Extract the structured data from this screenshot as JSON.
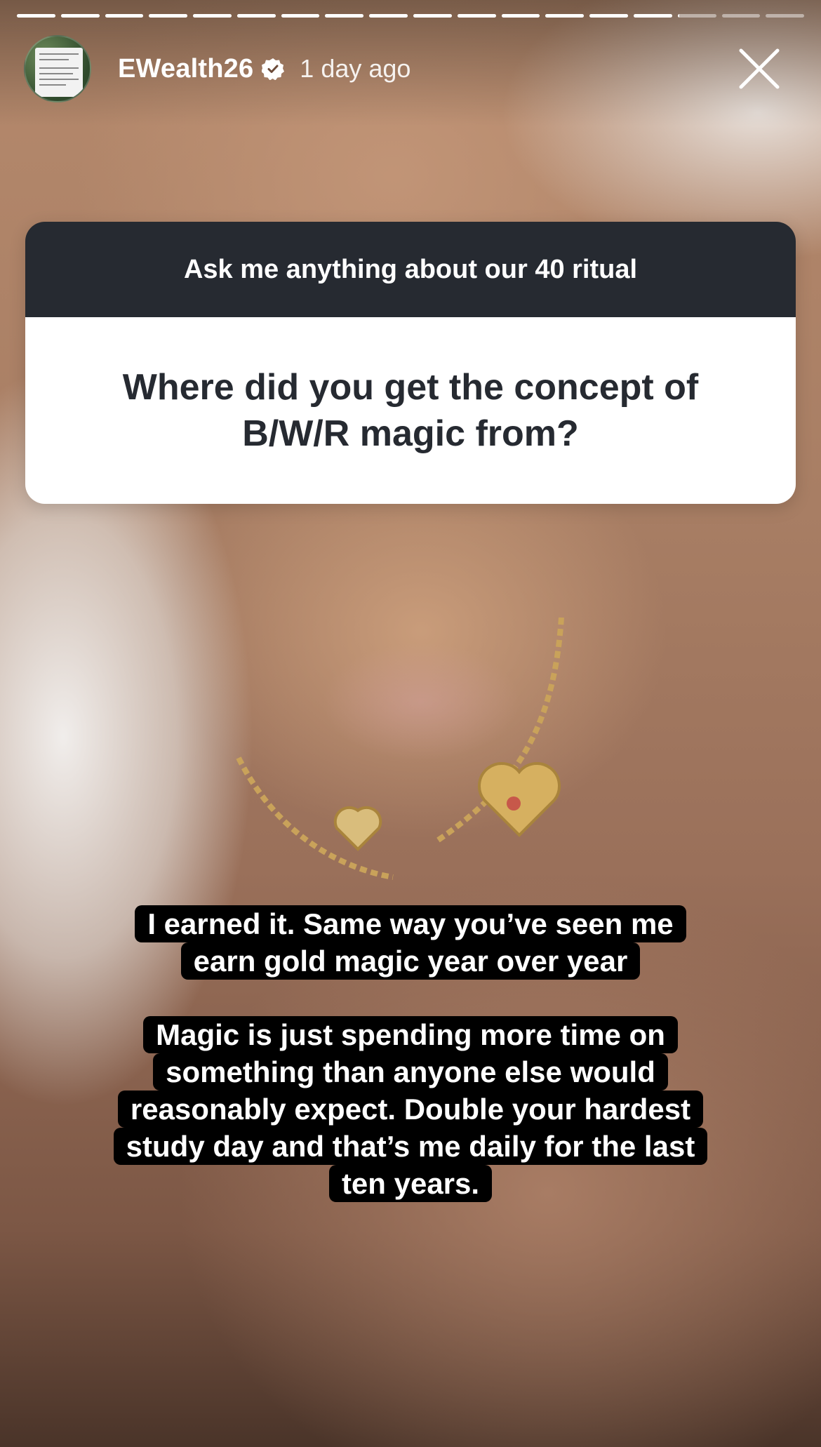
{
  "story": {
    "progress": {
      "segments_total": 18,
      "segments_completed": 15,
      "current_segment_progress": 0.05
    },
    "header": {
      "username": "EWealth26",
      "verified": true,
      "timestamp": "1 day ago",
      "avatar_icon": "story-avatar-thumbnail",
      "close_icon": "close-icon"
    },
    "question_sticker": {
      "prompt": "Ask me anything about our 40 ritual",
      "question": "Where did you get the concept of B/W/R magic from?"
    },
    "captions": {
      "first": [
        "I earned it. Same way you’ve seen me",
        "earn gold magic year over year"
      ],
      "second": [
        "Magic is just spending more time on",
        "something than anyone else would",
        "reasonably expect. Double your hardest",
        "study day and that’s me daily for the last",
        "ten years."
      ]
    },
    "colors": {
      "sticker_header": "#262a31",
      "sticker_body": "#ffffff",
      "caption_bg": "#000000",
      "caption_text": "#ffffff",
      "verified_badge": "#ffffff"
    }
  }
}
